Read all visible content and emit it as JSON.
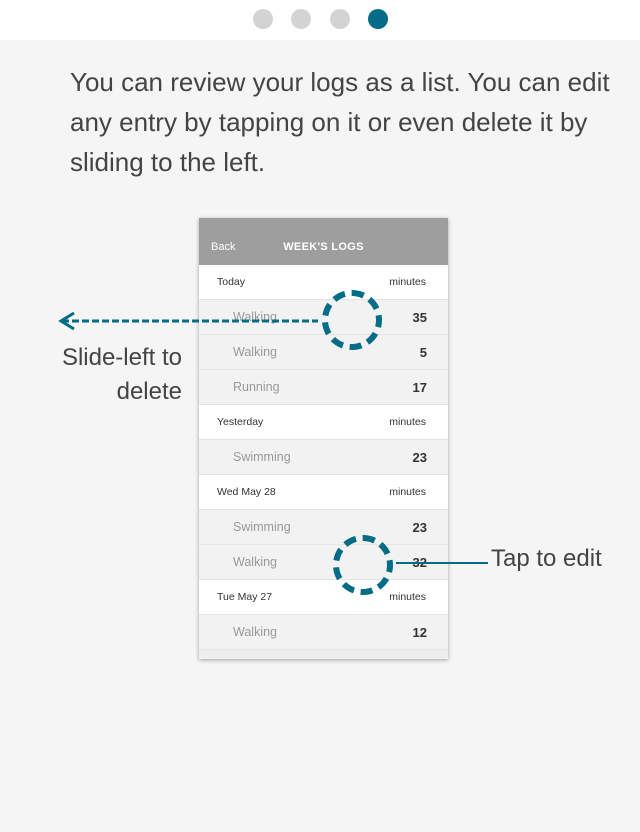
{
  "pager": {
    "total": 4,
    "active_index": 3
  },
  "intro_text": "You can review your logs as a list. You can edit any entry by tapping on it or even delete it by sliding to the left.",
  "phone": {
    "back_label": "Back",
    "title": "WEEK'S LOGS",
    "sections": [
      {
        "day": "Today",
        "unit": "minutes",
        "entries": [
          {
            "activity": "Walking",
            "minutes": "35"
          },
          {
            "activity": "Walking",
            "minutes": "5"
          },
          {
            "activity": "Running",
            "minutes": "17"
          }
        ]
      },
      {
        "day": "Yesterday",
        "unit": "minutes",
        "entries": [
          {
            "activity": "Swimming",
            "minutes": "23"
          }
        ]
      },
      {
        "day": "Wed May 28",
        "unit": "minutes",
        "entries": [
          {
            "activity": "Swimming",
            "minutes": "23"
          },
          {
            "activity": "Walking",
            "minutes": "32"
          }
        ]
      },
      {
        "day": "Tue May 27",
        "unit": "minutes",
        "entries": [
          {
            "activity": "Walking",
            "minutes": "12"
          }
        ]
      }
    ]
  },
  "callouts": {
    "slide_line1": "Slide-left to",
    "slide_line2": "delete",
    "tap": "Tap to edit"
  },
  "colors": {
    "accent": "#036c86",
    "header": "#9e9e9e",
    "dot_inactive": "#d3d3d3"
  }
}
